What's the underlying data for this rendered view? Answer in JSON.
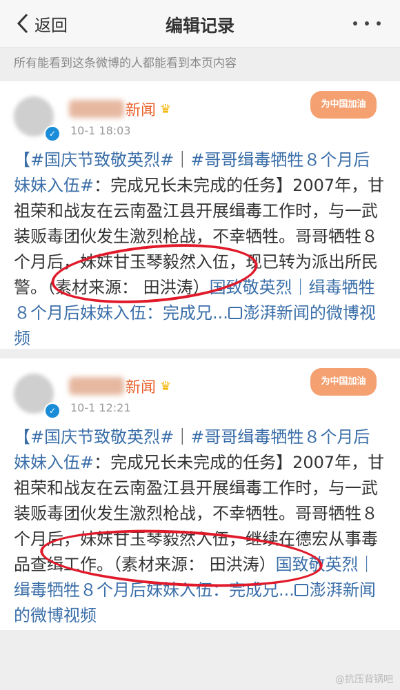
{
  "nav": {
    "back_label": "返回",
    "title": "编辑记录"
  },
  "notice": "所有能看到这条微博的人都能看到本页内容",
  "posts": [
    {
      "name": "新闻",
      "time": "10-1 18:03",
      "badge": "为中国加油",
      "tag1": "【#国庆节致敬英烈#",
      "sep": "｜",
      "tag2": "#哥哥缉毒牺牲８个月后妹妹入伍#",
      "body": "：完成兄长未完成的任务】2007年，甘祖荣和战友在云南盈江县开展缉毒工作时，与一武装贩毒团伙发生激烈枪战，不幸牺牲。哥哥牺牲８个月后，妹妹甘玉琴毅然入伍，现已转为派出所民警。（素材来源： 田洪涛）",
      "link1": "国致敬英烈｜缉毒牺牲８个月后妹妹入伍：完成兄...",
      "video": "澎湃新闻的微博视频"
    },
    {
      "name": "新闻",
      "time": "10-1 12:21",
      "badge": "为中国加油",
      "tag1": "【#国庆节致敬英烈#",
      "sep": "｜",
      "tag2": "#哥哥缉毒牺牲８个月后妹妹入伍#",
      "body": "：完成兄长未完成的任务】2007年，甘祖荣和战友在云南盈江县开展缉毒工作时，与一武装贩毒团伙发生激烈枪战，不幸牺牲。哥哥牺牲８个月后，妹妹甘玉琴毅然入伍，继续在德宏从事毒品查缉工作。（素材来源： 田洪涛）",
      "link1": "国致敬英烈｜缉毒牺牲８个月后妹妹入伍：完成兄...",
      "video": "澎湃新闻的微博视频"
    }
  ],
  "watermark": "@抗压背锅吧"
}
